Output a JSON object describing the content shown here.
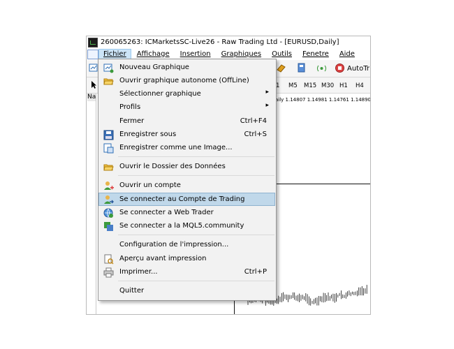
{
  "window": {
    "title": "260065263: ICMarketsSC-Live26 - Raw Trading Ltd - [EURUSD,Daily]"
  },
  "menubar": {
    "items": [
      "Fichier",
      "Affichage",
      "Insertion",
      "Graphiques",
      "Outils",
      "Fenetre",
      "Aide"
    ],
    "active": "Fichier"
  },
  "toolbar": {
    "autotrade_label": "AutoTr",
    "timeframes": [
      "1",
      "M5",
      "M15",
      "M30",
      "H1",
      "H4"
    ]
  },
  "navigator": {
    "tab_label": "Na"
  },
  "chart": {
    "header": "aily 1.14807 1.14981 1.14761 1.14890"
  },
  "file_menu": {
    "items": [
      {
        "label": "Nouveau Graphique",
        "shortcut": "",
        "submenu": false,
        "icon": "new-chart-icon"
      },
      {
        "label": "Ouvrir graphique autonome (OffLine)",
        "shortcut": "",
        "submenu": false,
        "icon": "open-folder-icon"
      },
      {
        "label": "Sélectionner graphique",
        "shortcut": "",
        "submenu": true,
        "icon": ""
      },
      {
        "label": "Profils",
        "shortcut": "",
        "submenu": true,
        "icon": ""
      },
      {
        "label": "Fermer",
        "shortcut": "Ctrl+F4",
        "submenu": false,
        "icon": ""
      },
      {
        "label": "Enregistrer sous",
        "shortcut": "Ctrl+S",
        "submenu": false,
        "icon": "save-icon"
      },
      {
        "label": "Enregistrer comme une Image...",
        "shortcut": "",
        "submenu": false,
        "icon": "save-image-icon"
      },
      {
        "label": "Ouvrir le Dossier des Données",
        "shortcut": "",
        "submenu": false,
        "icon": "data-folder-icon"
      },
      {
        "label": "Ouvrir un compte",
        "shortcut": "",
        "submenu": false,
        "icon": "add-account-icon"
      },
      {
        "label": "Se connecter au Compte de Trading",
        "shortcut": "",
        "submenu": false,
        "icon": "login-account-icon",
        "highlighted": true
      },
      {
        "label": "Se connecter a Web Trader",
        "shortcut": "",
        "submenu": false,
        "icon": "web-trader-icon"
      },
      {
        "label": "Se connecter a la MQL5.community",
        "shortcut": "",
        "submenu": false,
        "icon": "mql5-community-icon"
      },
      {
        "label": "Configuration de l'impression...",
        "shortcut": "",
        "submenu": false,
        "icon": ""
      },
      {
        "label": "Aperçu avant impression",
        "shortcut": "",
        "submenu": false,
        "icon": "print-preview-icon"
      },
      {
        "label": "Imprimer...",
        "shortcut": "Ctrl+P",
        "submenu": false,
        "icon": "printer-icon"
      },
      {
        "label": "Quitter",
        "shortcut": "",
        "submenu": false,
        "icon": ""
      }
    ]
  },
  "colors": {
    "highlight": "#c0d8ea",
    "menu_bg": "#f2f2f2",
    "accent_green": "#3c9a3c"
  }
}
